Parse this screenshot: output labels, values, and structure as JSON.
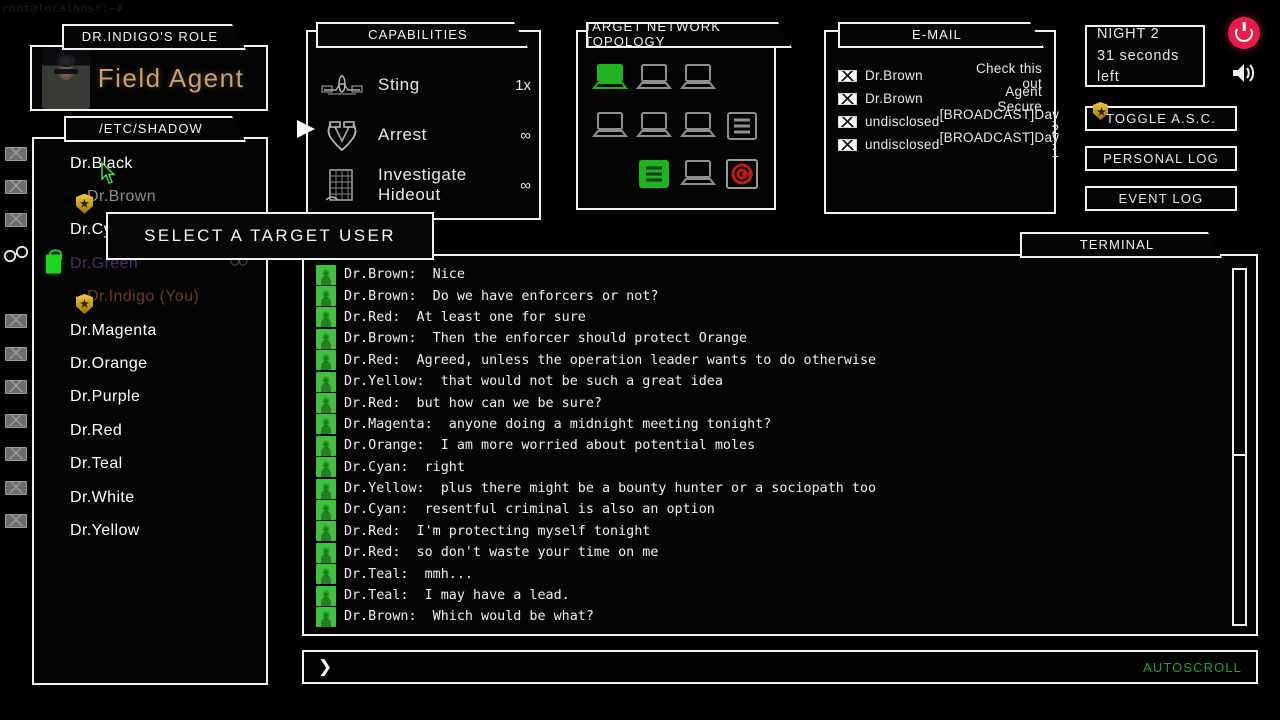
{
  "window": {
    "titlebar_text": "root@localhost:~#"
  },
  "role_panel": {
    "header": "Dr.Indigo's role",
    "role_name": "Field Agent",
    "avatar_icon": "agent-portrait"
  },
  "users_panel": {
    "header": "/etc/shadow",
    "users": [
      {
        "name": "Dr.Black",
        "color": "#ffffff",
        "badge": null,
        "rail_icon": "envelope-icon",
        "side_icon": null
      },
      {
        "name": "Dr.Brown",
        "color": "#8c8c8c",
        "badge": "shield",
        "rail_icon": "envelope-icon",
        "side_icon": "portrait-icon"
      },
      {
        "name": "Dr.Cyan",
        "color": "#ffffff",
        "badge": null,
        "rail_icon": "envelope-icon",
        "side_icon": null
      },
      {
        "name": "Dr.Green",
        "color": "#4a2f63",
        "badge": "lock",
        "rail_icon": "handcuffs-icon",
        "side_icon": "handcuffs-icon"
      },
      {
        "name": "Dr.Indigo (You)",
        "color": "#6a3b22",
        "badge": "shield",
        "rail_icon": null,
        "side_icon": null
      },
      {
        "name": "Dr.Magenta",
        "color": "#ffffff",
        "badge": null,
        "rail_icon": "envelope-icon",
        "side_icon": null
      },
      {
        "name": "Dr.Orange",
        "color": "#ffffff",
        "badge": null,
        "rail_icon": "envelope-icon",
        "side_icon": null
      },
      {
        "name": "Dr.Purple",
        "color": "#ffffff",
        "badge": null,
        "rail_icon": "envelope-icon",
        "side_icon": null
      },
      {
        "name": "Dr.Red",
        "color": "#ffffff",
        "badge": null,
        "rail_icon": "envelope-icon",
        "side_icon": null
      },
      {
        "name": "Dr.Teal",
        "color": "#ffffff",
        "badge": null,
        "rail_icon": "envelope-icon",
        "side_icon": null
      },
      {
        "name": "Dr.White",
        "color": "#ffffff",
        "badge": null,
        "rail_icon": "envelope-icon",
        "side_icon": null
      },
      {
        "name": "Dr.Yellow",
        "color": "#ffffff",
        "badge": null,
        "rail_icon": "envelope-icon",
        "side_icon": null
      }
    ]
  },
  "tooltip": {
    "text": "SELECT A TARGET USER"
  },
  "capabilities_panel": {
    "header": "CAPABILITIES",
    "items": [
      {
        "icon": "sting-icon",
        "label": "Sting",
        "count": "1x"
      },
      {
        "icon": "handcuffs-icon",
        "label": "Arrest",
        "count": "∞"
      },
      {
        "icon": "building-icon",
        "label": "Investigate Hideout",
        "count": "∞"
      }
    ],
    "selected_index": 1
  },
  "topology_panel": {
    "header": "TARGET NETWORK TOPOLOGY",
    "nodes": [
      {
        "type": "laptop",
        "state": "online"
      },
      {
        "type": "laptop",
        "state": "idle"
      },
      {
        "type": "laptop",
        "state": "idle"
      },
      {
        "type": "empty",
        "state": "none"
      },
      {
        "type": "laptop",
        "state": "idle"
      },
      {
        "type": "laptop",
        "state": "idle"
      },
      {
        "type": "laptop",
        "state": "idle"
      },
      {
        "type": "server",
        "state": "idle"
      },
      {
        "type": "empty",
        "state": "none"
      },
      {
        "type": "server",
        "state": "online"
      },
      {
        "type": "laptop",
        "state": "idle"
      },
      {
        "type": "disk",
        "state": "alert"
      }
    ]
  },
  "email_panel": {
    "header": "E-MAIL",
    "messages": [
      {
        "icon": "envelope-icon",
        "from": "Dr.Brown",
        "subject": "Check this out"
      },
      {
        "icon": "envelope-icon",
        "from": "Dr.Brown",
        "subject": "Agent Secure"
      },
      {
        "icon": "envelope-icon",
        "from": "undisclosed",
        "subject": "[BROADCAST]Day 2"
      },
      {
        "icon": "envelope-icon",
        "from": "undisclosed",
        "subject": "[BROADCAST]Day 1"
      }
    ]
  },
  "status_panel": {
    "night_label": "NIGHT 2",
    "timer_label": "31 seconds left",
    "power_icon": "power-icon",
    "sound_icon": "speaker-icon",
    "power_color": "#e81d49",
    "buttons": [
      {
        "label": "TOGGLE A.S.C.",
        "badge": "shield-icon"
      },
      {
        "label": "PERSONAL LOG",
        "badge": null
      },
      {
        "label": "EVENT LOG",
        "badge": null
      }
    ]
  },
  "terminal": {
    "header": "TERMINAL",
    "prompt_symbol": "❯",
    "autoscroll_label": "AUTOSCROLL",
    "autoscroll_color": "#25a02b",
    "messages": [
      {
        "avatar": "avatar-icon",
        "text": "Dr.Brown:  Nice"
      },
      {
        "avatar": "avatar-icon",
        "text": "Dr.Brown:  Do we have enforcers or not?"
      },
      {
        "avatar": "avatar-icon",
        "text": "Dr.Red:  At least one for sure"
      },
      {
        "avatar": "avatar-icon",
        "text": "Dr.Brown:  Then the enforcer should protect Orange"
      },
      {
        "avatar": "avatar-icon",
        "text": "Dr.Red:  Agreed, unless the operation leader wants to do otherwise"
      },
      {
        "avatar": "avatar-icon",
        "text": "Dr.Yellow:  that would not be such a great idea"
      },
      {
        "avatar": "avatar-icon",
        "text": "Dr.Red:  but how can we be sure?"
      },
      {
        "avatar": "avatar-icon",
        "text": "Dr.Magenta:  anyone doing a midnight meeting tonight?"
      },
      {
        "avatar": "avatar-icon",
        "text": "Dr.Orange:  I am more worried about potential moles"
      },
      {
        "avatar": "avatar-icon",
        "text": "Dr.Cyan:  right"
      },
      {
        "avatar": "avatar-icon",
        "text": "Dr.Yellow:  plus there might be a bounty hunter or a sociopath too"
      },
      {
        "avatar": "avatar-icon",
        "text": "Dr.Cyan:  resentful criminal is also an option"
      },
      {
        "avatar": "avatar-icon",
        "text": "Dr.Red:  I'm protecting myself tonight"
      },
      {
        "avatar": "avatar-icon",
        "text": "Dr.Red:  so don't waste your time on me"
      },
      {
        "avatar": "avatar-icon",
        "text": "Dr.Teal:  mmh..."
      },
      {
        "avatar": "avatar-icon",
        "text": "Dr.Teal:  I may have a lead."
      },
      {
        "avatar": "avatar-icon",
        "text": "Dr.Brown:  Which would be what?"
      }
    ]
  }
}
